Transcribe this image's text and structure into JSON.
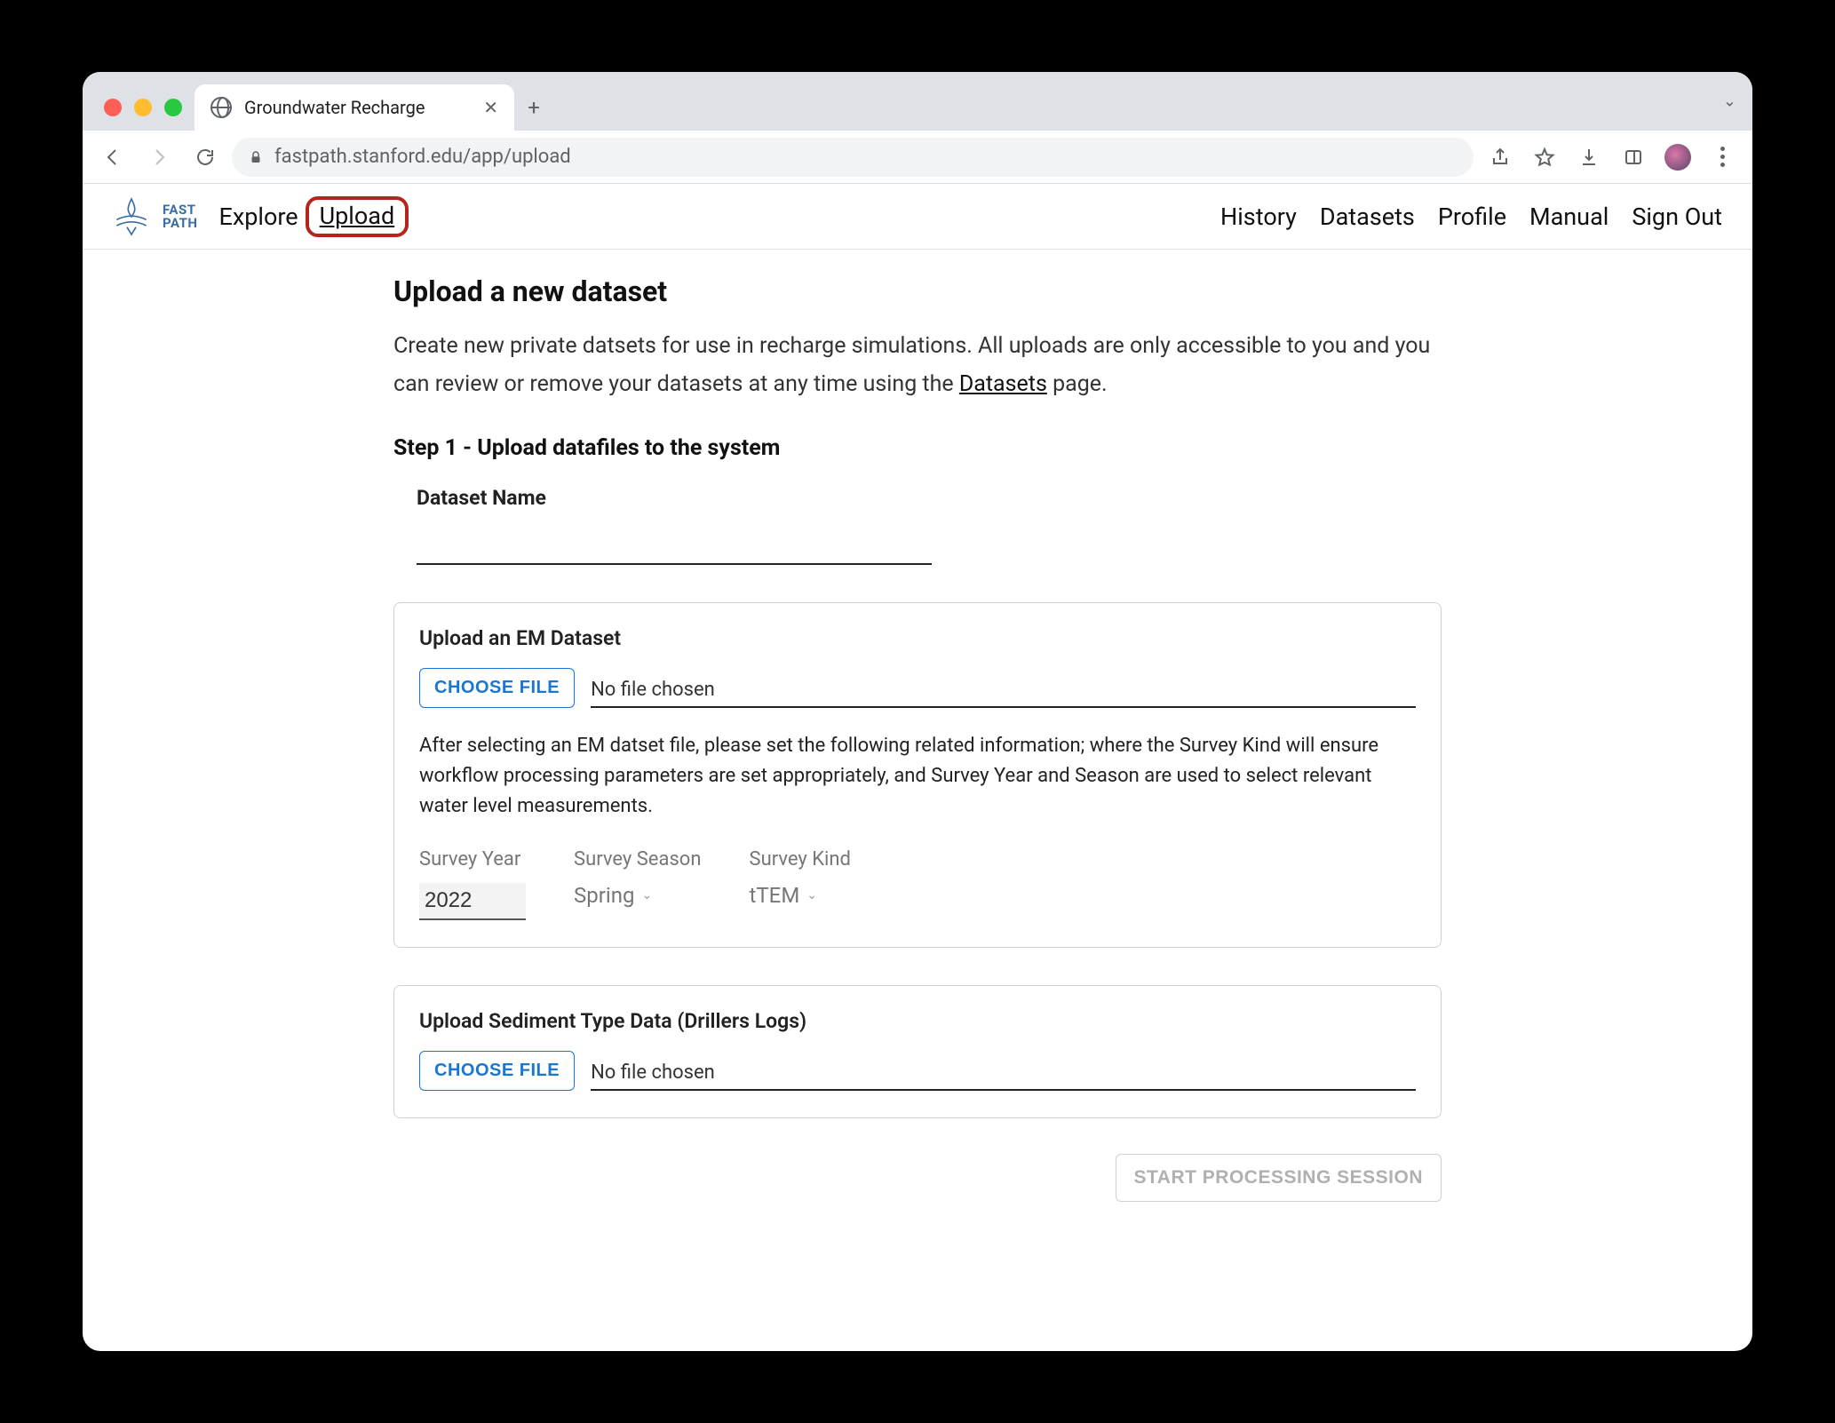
{
  "browser": {
    "tab_title": "Groundwater Recharge",
    "url": "fastpath.stanford.edu/app/upload"
  },
  "logo": {
    "line1": "FAST",
    "line2": "PATH"
  },
  "nav": {
    "left": [
      "Explore",
      "Upload"
    ],
    "active": "Upload",
    "right": [
      "History",
      "Datasets",
      "Profile",
      "Manual",
      "Sign Out"
    ]
  },
  "page": {
    "title": "Upload a new dataset",
    "intro_before": "Create new private datsets for use in recharge simulations. All uploads are only accessible to you and you can review or remove your datasets at any time using the ",
    "intro_link": "Datasets",
    "intro_after": " page.",
    "step_heading": "Step 1 - Upload datafiles to the system",
    "dataset_name_label": "Dataset Name",
    "dataset_name_value": ""
  },
  "em_card": {
    "title": "Upload an EM Dataset",
    "choose_label": "CHOOSE FILE",
    "file_text": "No file chosen",
    "desc": "After selecting an EM datset file, please set the following related information; where the Survey Kind will ensure workflow processing parameters are set appropriately, and Survey Year and Season are used to select relevant water level measurements.",
    "survey_year_label": "Survey Year",
    "survey_year_value": "2022",
    "survey_season_label": "Survey Season",
    "survey_season_value": "Spring",
    "survey_kind_label": "Survey Kind",
    "survey_kind_value": "tTEM"
  },
  "sediment_card": {
    "title": "Upload Sediment Type Data (Drillers Logs)",
    "choose_label": "CHOOSE FILE",
    "file_text": "No file chosen"
  },
  "actions": {
    "start_label": "START PROCESSING SESSION"
  }
}
